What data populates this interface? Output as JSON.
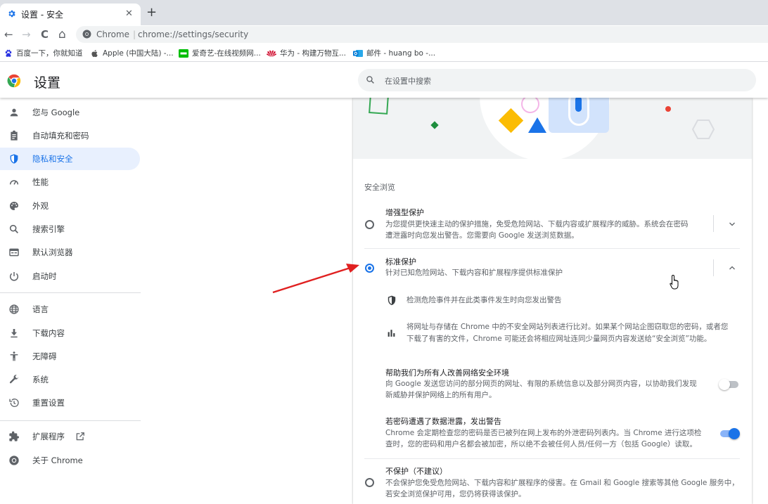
{
  "tab": {
    "title": "设置 - 安全",
    "close": "✕",
    "new_tab": "+"
  },
  "toolbar": {
    "back": "←",
    "forward": "→",
    "reload": "C",
    "home": "⌂"
  },
  "omnibox": {
    "host": "Chrome",
    "separator": "|",
    "url": "chrome://settings/security"
  },
  "bookmarks": [
    {
      "label": "百度一下，你就知道",
      "icon": "paw-icon",
      "color": "#2932e1"
    },
    {
      "label": "Apple (中国大陆) -...",
      "icon": "apple-icon",
      "color": "#555555"
    },
    {
      "label": "爱奇艺-在线视频网...",
      "icon": "iqiyi-icon",
      "color": "#00be06"
    },
    {
      "label": "华为 - 构建万物互...",
      "icon": "huawei-icon",
      "color": "#cf0a2c"
    },
    {
      "label": "邮件 - huang bo -...",
      "icon": "outlook-icon",
      "color": "#0078d4"
    }
  ],
  "header": {
    "title": "设置",
    "search_placeholder": "在设置中搜索"
  },
  "sidebar": {
    "items": [
      {
        "label": "您与 Google",
        "icon": "person-icon"
      },
      {
        "label": "自动填充和密码",
        "icon": "clipboard-icon"
      },
      {
        "label": "隐私和安全",
        "icon": "shield-icon",
        "active": true
      },
      {
        "label": "性能",
        "icon": "speedometer-icon"
      },
      {
        "label": "外观",
        "icon": "palette-icon"
      },
      {
        "label": "搜索引擎",
        "icon": "search-icon"
      },
      {
        "label": "默认浏览器",
        "icon": "browser-icon"
      },
      {
        "label": "启动时",
        "icon": "power-icon"
      },
      {
        "label": "语言",
        "icon": "globe-icon"
      },
      {
        "label": "下载内容",
        "icon": "download-icon"
      },
      {
        "label": "无障碍",
        "icon": "accessibility-icon"
      },
      {
        "label": "系统",
        "icon": "wrench-icon"
      },
      {
        "label": "重置设置",
        "icon": "history-icon"
      },
      {
        "label": "扩展程序",
        "icon": "puzzle-icon"
      },
      {
        "label": "关于 Chrome",
        "icon": "chrome-icon"
      }
    ]
  },
  "main": {
    "section_title": "安全浏览",
    "options": {
      "enhanced": {
        "title": "增强型保护",
        "desc1": "为您提供更快速主动的保护措施，免受危险网站、下载内容或扩展程序的威胁。系统会在密码",
        "desc2": "遭泄露时向您发出警告。您需要向 Google 发送浏览数据。",
        "selected": false
      },
      "standard": {
        "title": "标准保护",
        "desc": "针对已知危险网站、下载内容和扩展程序提供标准保护",
        "selected": true,
        "sub1": "检测危险事件并在此类事件发生时向您发出警告",
        "sub2a": "将网址与存储在 Chrome 中的不安全网站列表进行比对。如果某个网站企图窃取您的密码，或者您",
        "sub2b": "下载了有害的文件，Chrome 可能还会将相应网址连同少量网页内容发送给“安全浏览”功能。"
      },
      "none": {
        "title": "不保护（不建议）",
        "desc1": "不会保护您免受危险网站、下载内容和扩展程序的侵害。在 Gmail 和 Google 搜索等其他 Google 服务中，",
        "desc2": "若安全浏览保护可用，您仍将获得该保护。",
        "selected": false
      }
    },
    "improve": {
      "title": "帮助我们为所有人改善网络安全环境",
      "desc1": "向 Google 发送您访问的部分网页的网址、有限的系统信息以及部分网页内容，以协助我们发现",
      "desc2": "新威胁并保护网络上的所有用户。",
      "enabled": false
    },
    "password_warn": {
      "title": "若密码遭遇了数据泄露，发出警告",
      "desc1": "Chrome 会定期检查您的密码是否已被列在网上发布的外泄密码列表内。当 Chrome 进行这项检",
      "desc2": "查时，您的密码和用户名都会被加密，所以绝不会被任何人员/任何一方（包括 Google）读取。",
      "enabled": true
    }
  },
  "colors": {
    "accent": "#1a73e8",
    "annotation_arrow": "#e02020"
  }
}
